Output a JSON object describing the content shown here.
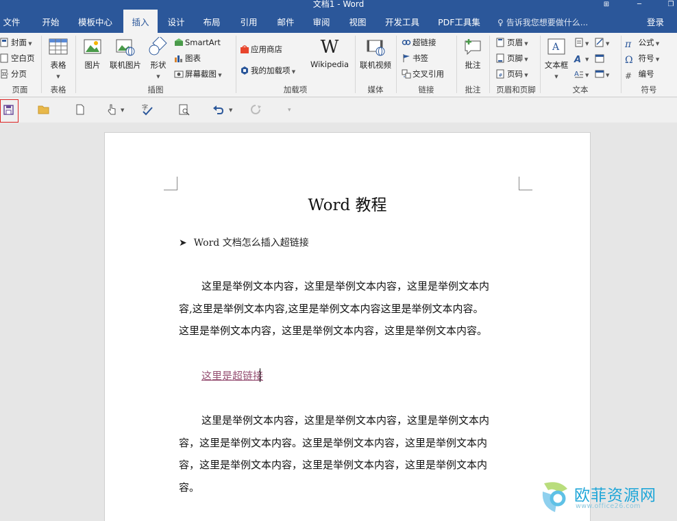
{
  "window": {
    "title": "文档1 - Word"
  },
  "tabs": [
    {
      "label": "文件",
      "active": false
    },
    {
      "label": "开始",
      "active": false
    },
    {
      "label": "模板中心",
      "active": false
    },
    {
      "label": "插入",
      "active": true
    },
    {
      "label": "设计",
      "active": false
    },
    {
      "label": "布局",
      "active": false
    },
    {
      "label": "引用",
      "active": false
    },
    {
      "label": "邮件",
      "active": false
    },
    {
      "label": "审阅",
      "active": false
    },
    {
      "label": "视图",
      "active": false
    },
    {
      "label": "开发工具",
      "active": false
    },
    {
      "label": "PDF工具集",
      "active": false
    }
  ],
  "tell_me": "告诉我您想要做什么...",
  "login": "登录",
  "ribbon": {
    "pages": {
      "label": "页面",
      "items": [
        "封面",
        "空白页",
        "分页"
      ]
    },
    "tables": {
      "label": "表格",
      "button": "表格"
    },
    "illustrations": {
      "label": "插图",
      "picture": "图片",
      "online_picture": "联机图片",
      "shapes": "形状",
      "smartart": "SmartArt",
      "chart": "图表",
      "screenshot": "屏幕截图"
    },
    "addins": {
      "label": "加载项",
      "store": "应用商店",
      "my_addins": "我的加载项",
      "wikipedia": "Wikipedia"
    },
    "media": {
      "label": "媒体",
      "online_video": "联机视频"
    },
    "links": {
      "label": "链接",
      "hyperlink": "超链接",
      "bookmark": "书签",
      "cross_ref": "交叉引用"
    },
    "comments": {
      "label": "批注",
      "comment": "批注"
    },
    "header_footer": {
      "label": "页眉和页脚",
      "header": "页眉",
      "footer": "页脚",
      "page_number": "页码"
    },
    "text": {
      "label": "文本",
      "textbox": "文本框"
    },
    "symbols": {
      "label": "符号",
      "equation": "公式",
      "symbol": "符号",
      "number": "编号"
    }
  },
  "document": {
    "title": "Word 教程",
    "bullet": "Word 文档怎么插入超链接",
    "para1": [
      "这里是举例文本内容，这里是举例文本内容，这里是举例文本内",
      "容,这里是举例文本内容,这里是举例文本内容这里是举例文本内容。",
      "这里是举例文本内容，这里是举例文本内容，这里是举例文本内容。"
    ],
    "link_text": "这里是超链接",
    "para2": [
      "这里是举例文本内容，这里是举例文本内容，这里是举例文本内",
      "容，这里是举例文本内容。这里是举例文本内容，这里是举例文本内",
      "容，这里是举例文本内容，这里是举例文本内容，这里是举例文本内",
      "容。"
    ]
  },
  "watermark": {
    "brand": "欧菲资源网",
    "url": "www.office26.com"
  },
  "colors": {
    "accent": "#2b579a",
    "link": "#954f72",
    "save_highlight": "#dd2222"
  }
}
